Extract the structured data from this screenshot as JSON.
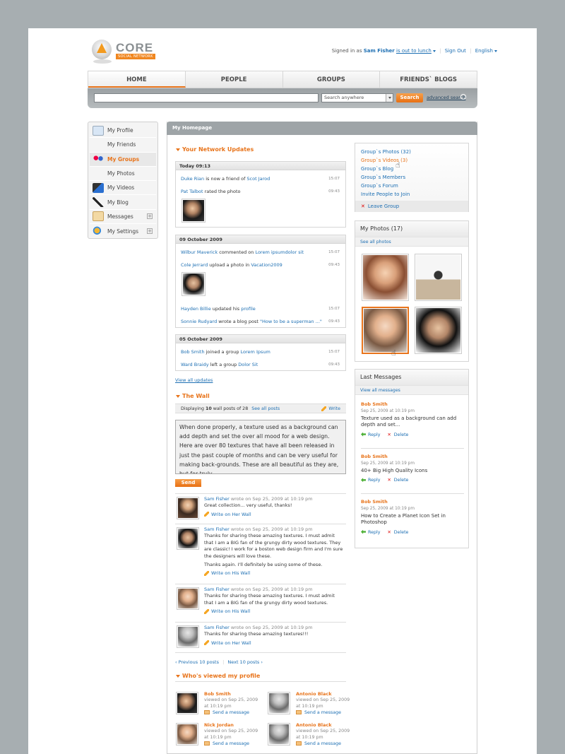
{
  "logo": {
    "name": "CORE",
    "tagline": "SOCIAL NETWORK"
  },
  "userbar": {
    "signed_in_as": "Signed in as",
    "user": "Sam Fisher",
    "status": "is out to lunch",
    "sign_out": "Sign Out",
    "language": "English"
  },
  "nav": [
    {
      "label": "HOME"
    },
    {
      "label": "PEOPLE"
    },
    {
      "label": "GROUPS"
    },
    {
      "label": "FRIENDS` BLOGS"
    }
  ],
  "search": {
    "scope": "Search anywhere",
    "button": "Search",
    "advanced": "advanced search"
  },
  "sidebar": [
    {
      "label": "My Profile",
      "icon": "profile-card-icon"
    },
    {
      "label": "My Friends",
      "icon": "friends-icon"
    },
    {
      "label": "My Groups",
      "icon": "group-icon"
    },
    {
      "label": "My Photos",
      "icon": "photos-icon"
    },
    {
      "label": "My Videos",
      "icon": "film-icon"
    },
    {
      "label": "My Blog",
      "icon": "quill-icon"
    },
    {
      "label": "Messages",
      "icon": "envelope-icon",
      "expand": "+"
    },
    {
      "label": "My Settings",
      "icon": "gears-icon",
      "expand": "+"
    }
  ],
  "main_title": "My Homepage",
  "updates": {
    "title": "Your Network Updates",
    "groups": [
      {
        "date": "Today 09:13",
        "items": [
          {
            "who": "Duke Rian",
            "text": " is now a friend of ",
            "obj": "Scot Jarod",
            "time": "15:07"
          },
          {
            "who": "Pat Talbot",
            "text": " rated the photo",
            "obj": "",
            "time": "09:43"
          }
        ]
      },
      {
        "date": "09 October 2009",
        "items": [
          {
            "who": "Wilbur Maverick",
            "text": " commented on ",
            "obj": "Lorem ipsumdolor sit",
            "time": "15:07"
          },
          {
            "who": "Cole Jerrard",
            "text": " upload a photo in ",
            "obj": "Vacation2009",
            "time": "09:43"
          },
          {
            "who": "Hayden Billie",
            "text": " updated his ",
            "obj": "profile",
            "time": "15:07"
          },
          {
            "who": "Sonnie Rudyard",
            "text": " wrote a blog post ",
            "obj": "\"How to be a superman ...\"",
            "time": "09:43"
          }
        ]
      },
      {
        "date": "05 October 2009",
        "items": [
          {
            "who": "Bob Smith",
            "text": " joined a group ",
            "obj": "Lorem Ipsum",
            "time": "15:07"
          },
          {
            "who": "Ward Braidy",
            "text": " left a group ",
            "obj": "Dolor Sit",
            "time": "09:43"
          }
        ]
      }
    ],
    "view_all": "View all updates"
  },
  "wall": {
    "title": "The Wall",
    "displaying_pre": "Displaying ",
    "displaying_count": "10",
    "displaying_post": " wall posts of 28",
    "see_all": "See all posts",
    "write": "Write",
    "textarea": "When done properly, a texture used as a background can add depth and set the over all mood for a web design. Here are over 80 textures that have all been released in just the past couple of months and can be very useful for making back-grounds. These are all beautiful as they are, but for truly",
    "send": "Send",
    "posts": [
      {
        "who": "Sam Fisher",
        "meta": " wrote on Sep 25, 2009 at 10:19 pm",
        "text": "Great collection... very useful, thanks!",
        "text2": "",
        "write": "Write on Her Wall"
      },
      {
        "who": "Sam Fisher",
        "meta": " wrote on Sep 25, 2009 at 10:19 pm",
        "text": "Thanks for sharing these amazing textures. I must admit that I am a BIG fan of the grungy dirty wood textures. They are classic! I work for a  boston web design firm and I'm sure the designers will love these.",
        "text2": "Thanks again. I'll definitely be using some of these.",
        "write": "Write on His Wall"
      },
      {
        "who": "Sam Fisher",
        "meta": " wrote on Sep 25, 2009 at 10:19 pm",
        "text": "Thanks for sharing these amazing textures. I must admit that I am a BIG fan of the grungy dirty wood textures.",
        "text2": "",
        "write": "Write on His Wall"
      },
      {
        "who": "Sam Fisher",
        "meta": " wrote on Sep 25, 2009 at 10:19 pm",
        "text": "Thanks for sharing these amazing textures!!!",
        "text2": "",
        "write": "Write on Her Wall"
      }
    ],
    "prev": "Previous 10 posts",
    "next": "Next 10 posts"
  },
  "viewers": {
    "title": "Who's viewed my profile",
    "items": [
      {
        "name": "Bob Smith",
        "viewed": "viewed on Sep 25, 2009 at 10:19 pm",
        "send": "Send a message"
      },
      {
        "name": "Antonio Black",
        "viewed": "viewed on Sep 25, 2009 at 10:19 pm",
        "send": "Send a message"
      },
      {
        "name": "Nick Jordan",
        "viewed": "viewed on Sep 25, 2009 at 10:19 pm",
        "send": "Send a message"
      },
      {
        "name": "Antonio Black",
        "viewed": "viewed on Sep 25, 2009 at 10:19 pm",
        "send": "Send a message"
      }
    ]
  },
  "group_links": {
    "items": [
      "Group`s Photos (32)",
      "Group`s Videos (3)",
      "Group`s Blog",
      "Group`s Members",
      "Group`s Forum",
      "Invite People to Join"
    ],
    "leave": "Leave Group"
  },
  "photos": {
    "title": "My Photos (17)",
    "see_all": "See all photos"
  },
  "messages": {
    "title": "Last Messages",
    "view_all": "View all messages",
    "items": [
      {
        "name": "Bob Smith",
        "date": "Sep 25, 2009 at 10:19 pm",
        "text": "Texture used as a background can add depth and set...",
        "reply": "Reply",
        "delete": "Delete"
      },
      {
        "name": "Bob Smith",
        "date": "Sep 25, 2009 at 10:19 pm",
        "text": "40+ Big High Quality Icons",
        "reply": "Reply",
        "delete": "Delete"
      },
      {
        "name": "Bob Smith",
        "date": "Sep 25, 2009 at 10:19 pm",
        "text": "How to Create a Planet Icon Set in Photoshop",
        "reply": "Reply",
        "delete": "Delete"
      }
    ]
  },
  "colors": {
    "accent": "#e8741b",
    "link": "#1d6fb3",
    "background": "#a7aeb1"
  }
}
